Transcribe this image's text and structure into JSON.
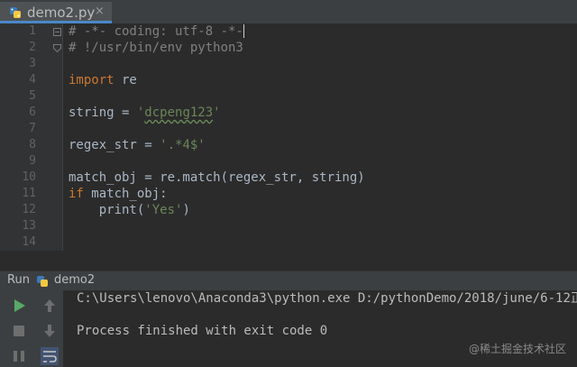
{
  "tab": {
    "title": "demo2.py",
    "close": "×"
  },
  "editor": {
    "line_numbers": [
      "1",
      "2",
      "3",
      "4",
      "5",
      "6",
      "7",
      "8",
      "9",
      "10",
      "11",
      "12",
      "13",
      "14"
    ],
    "lines": {
      "l1": "# -*- coding: utf-8 -*-",
      "l2": "# !/usr/bin/env python3",
      "l4_kw": "import",
      "l4_rest": " re",
      "l6_pre": "string = ",
      "l6_q1": "'",
      "l6_str": "dcpeng123",
      "l6_q2": "'",
      "l8_pre": "regex_str = ",
      "l8_str": "'.*4$'",
      "l10": "match_obj = re.match(regex_str, string)",
      "l11_kw": "if",
      "l11_rest": " match_obj:",
      "l12_pre": "    print(",
      "l12_str": "'Yes'",
      "l12_post": ")"
    }
  },
  "run": {
    "title": "Run",
    "config": "demo2",
    "console": [
      "C:\\Users\\lenovo\\Anaconda3\\python.exe D:/pythonDemo/2018/june/6-12正",
      "Process finished with exit code 0"
    ]
  },
  "watermark": "@稀土掘金技术社区",
  "colors": {
    "background": "#2b2b2b",
    "keyword": "#cc7832",
    "comment": "#808080",
    "string": "#6a8759",
    "run_green": "#59a869"
  }
}
